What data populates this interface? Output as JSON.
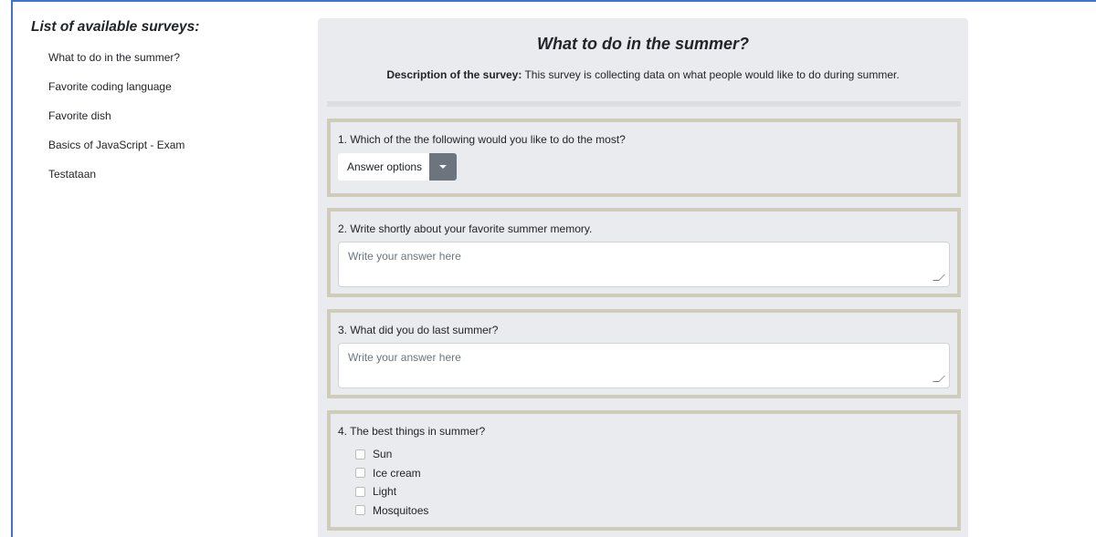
{
  "sidebar": {
    "title": "List of available surveys:",
    "items": [
      {
        "label": "What to do in the summer?"
      },
      {
        "label": "Favorite coding language"
      },
      {
        "label": "Favorite dish"
      },
      {
        "label": "Basics of JavaScript - Exam"
      },
      {
        "label": "Testataan"
      }
    ]
  },
  "survey": {
    "title": "What to do in the summer?",
    "description_label": "Description of the survey:",
    "description_text": " This survey is collecting data on what people would like to do during summer.",
    "questions": [
      {
        "text": "1. Which of the the following would you like to do the most?",
        "dropdown_label": "Answer options"
      },
      {
        "text": "2. Write shortly about your favorite summer memory.",
        "placeholder": "Write your answer here"
      },
      {
        "text": "3. What did you do last summer?",
        "placeholder": "Write your answer here"
      },
      {
        "text": "4. The best things in summer?",
        "options": [
          {
            "label": "Sun"
          },
          {
            "label": "Ice cream"
          },
          {
            "label": "Light"
          },
          {
            "label": "Mosquitoes"
          }
        ]
      }
    ]
  },
  "colors": {
    "frame_border": "#4472c4",
    "panel_bg": "#e9ebee",
    "question_border": "#cfccbb",
    "dropdown_toggle": "#6c757d"
  }
}
